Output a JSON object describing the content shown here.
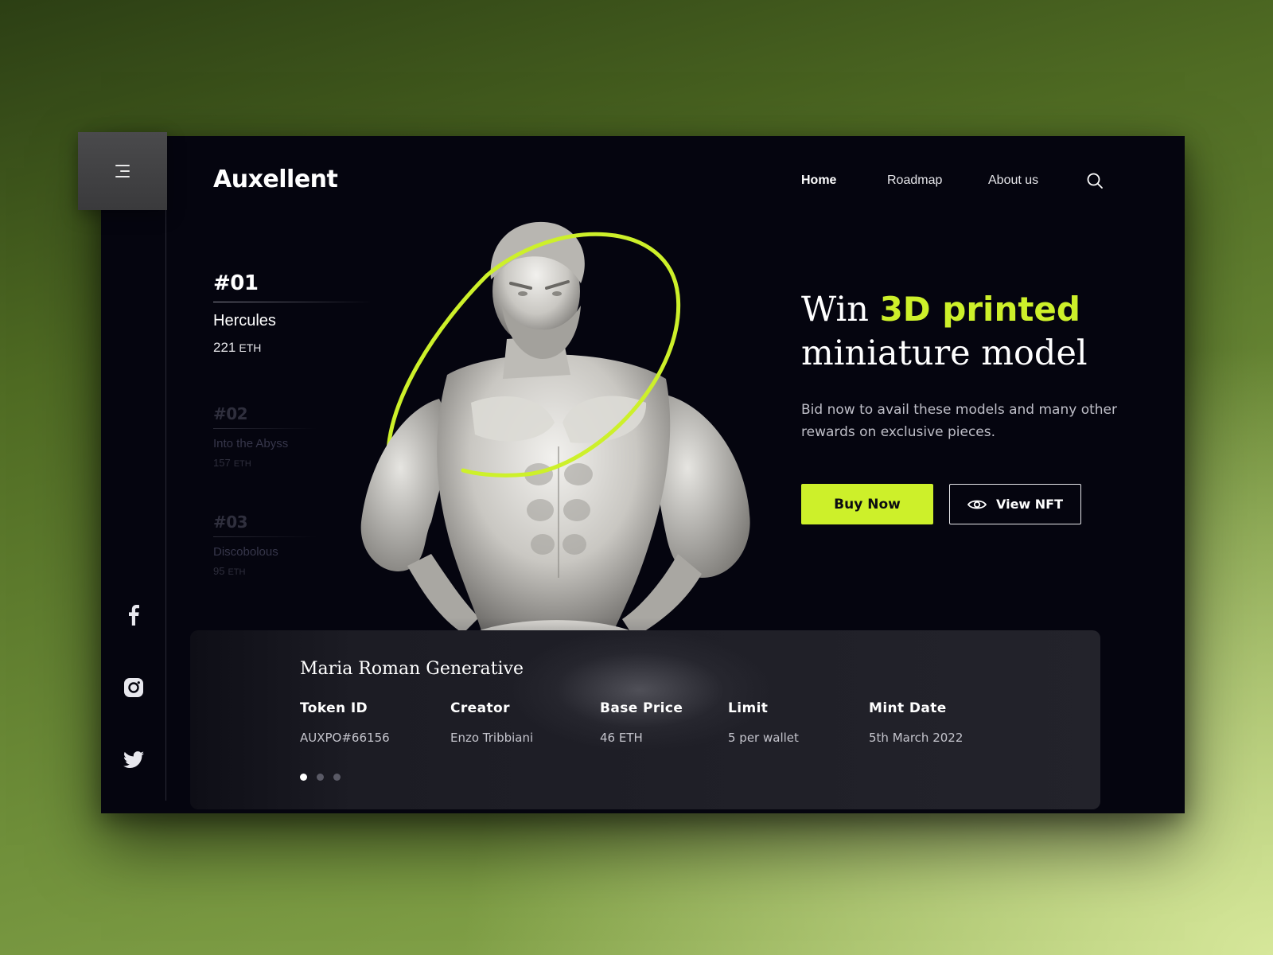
{
  "brand": {
    "name": "Auxellent"
  },
  "nav": [
    {
      "label": "Home",
      "active": true
    },
    {
      "label": "Roadmap",
      "active": false
    },
    {
      "label": "About us",
      "active": false
    }
  ],
  "icons": {
    "menu": "menu-icon",
    "search": "search-icon",
    "eye": "eye-icon",
    "facebook": "facebook-icon",
    "instagram": "instagram-icon",
    "twitter": "twitter-icon"
  },
  "lots": [
    {
      "number": "#01",
      "name": "Hercules",
      "price": "221",
      "unit": "ETH",
      "active": true
    },
    {
      "number": "#02",
      "name": "Into the Abyss",
      "price": "157",
      "unit": "ETH",
      "active": false
    },
    {
      "number": "#03",
      "name": "Discobolous",
      "price": "95",
      "unit": "ETH",
      "active": false
    }
  ],
  "hero": {
    "headline_pre": "Win ",
    "headline_highlight": "3D printed",
    "headline_post": "miniature model",
    "subcopy": "Bid now to avail these models and many other rewards on exclusive pieces.",
    "buy_label": "Buy Now",
    "view_label": "View NFT"
  },
  "collection": {
    "title": "Maria Roman Generative",
    "stats": [
      {
        "label": "Token ID",
        "value": "AUXPO#66156"
      },
      {
        "label": "Creator",
        "value": "Enzo Tribbiani"
      },
      {
        "label": "Base Price",
        "value": "46 ETH"
      },
      {
        "label": "Limit",
        "value": "5 per wallet"
      },
      {
        "label": "Mint Date",
        "value": "5th March 2022"
      }
    ],
    "slide_count": 3,
    "active_slide": 1
  },
  "colors": {
    "accent": "#cdf02a",
    "background": "#05050f",
    "panel": "#23232b"
  }
}
